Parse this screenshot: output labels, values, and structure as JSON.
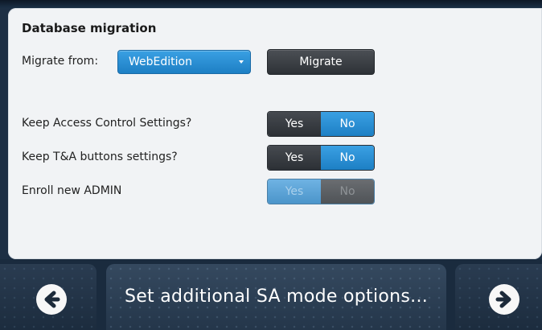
{
  "panel": {
    "title": "Database migration",
    "migrate_from_label": "Migrate from:",
    "migrate_from_value": "WebEdition",
    "migrate_button": "Migrate",
    "settings": [
      {
        "label": "Keep Access Control Settings?",
        "yes": "Yes",
        "no": "No",
        "selected": "No",
        "enabled": true
      },
      {
        "label": "Keep T&A buttons settings?",
        "yes": "Yes",
        "no": "No",
        "selected": "No",
        "enabled": true
      },
      {
        "label": "Enroll new ADMIN",
        "yes": "Yes",
        "no": "No",
        "selected": "Yes",
        "enabled": false
      }
    ]
  },
  "footer": {
    "back_icon": "arrow-left-circle-icon",
    "next_icon": "arrow-right-circle-icon",
    "center_text": "Set additional SA mode options..."
  },
  "colors": {
    "accent": "#2b8fd6",
    "dark_button": "#3a3e43",
    "panel_bg": "#f1f3f5",
    "footer_bg": "#1a2b3e"
  }
}
